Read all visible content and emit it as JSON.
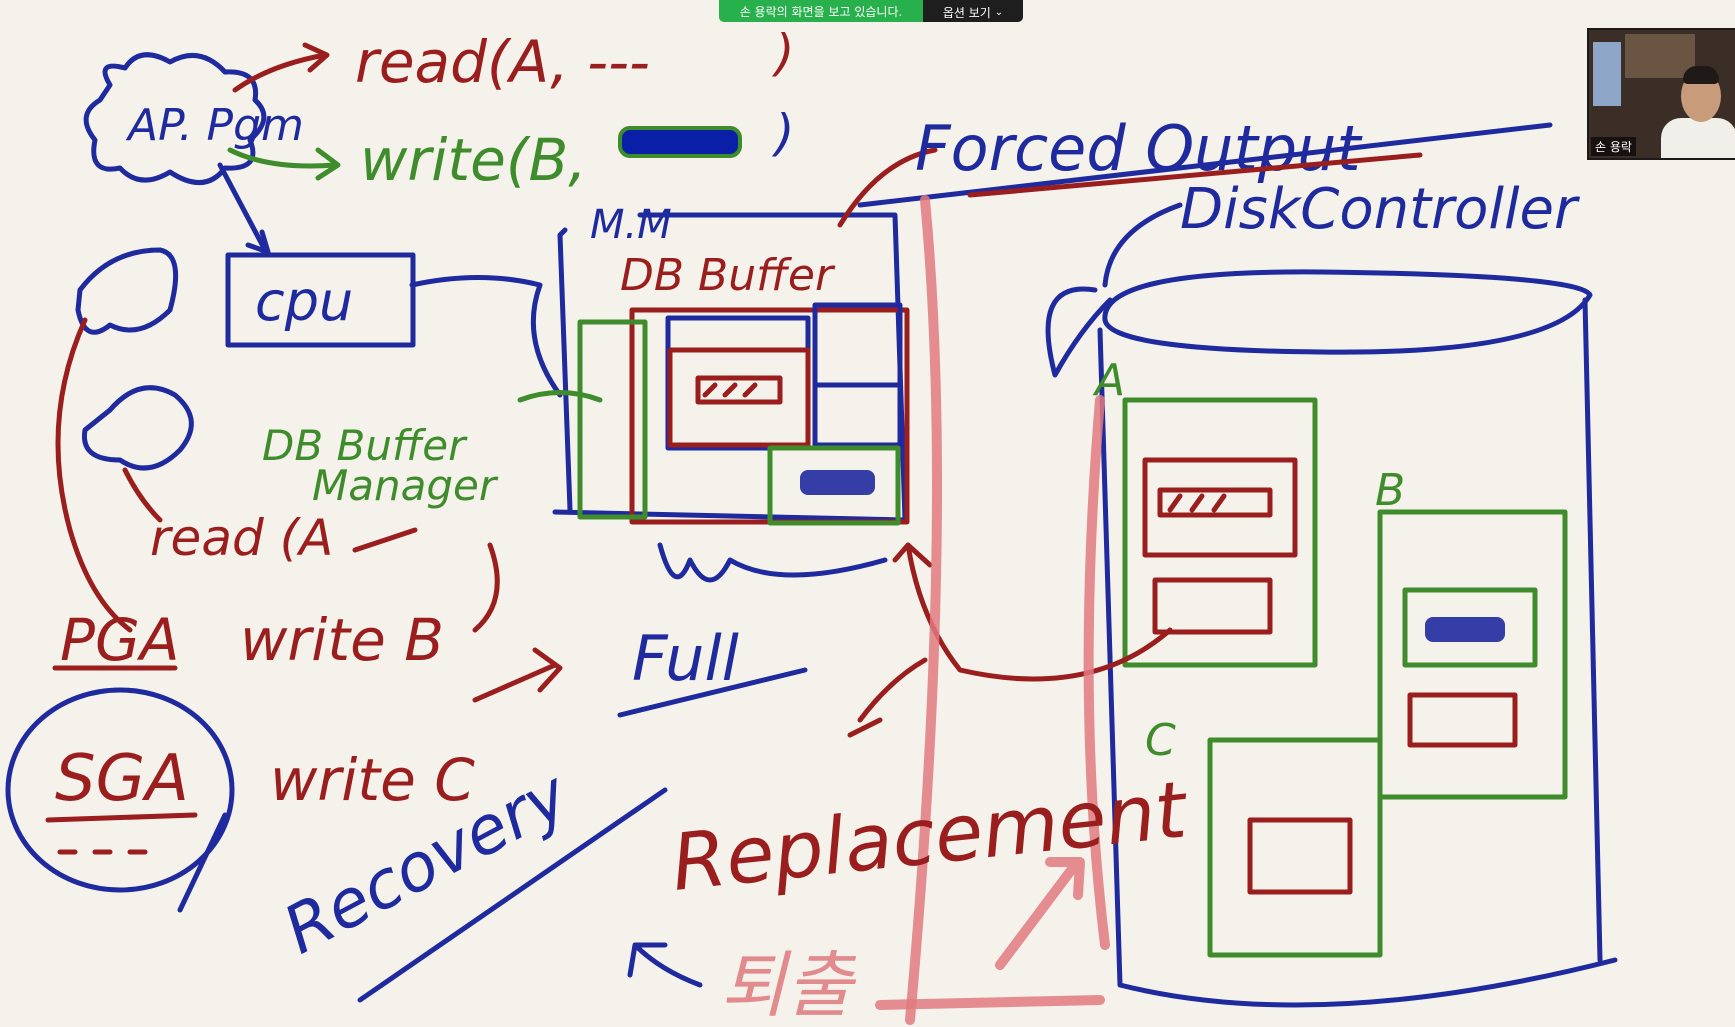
{
  "share_bar": {
    "status_text": "손 용락의 화면을 보고 있습니다.",
    "view_options_label": "옵션 보기",
    "status_color": "#27b04b"
  },
  "participant": {
    "name": "손 용락"
  },
  "whiteboard": {
    "ap_pgm": "AP. Pgm",
    "read_a": "read(A, ---",
    "write_b": "write(B,",
    "cpu": "cpu",
    "mm": "M.M",
    "db_buffer": "DB Buffer",
    "db_buffer_manager_1": "DB Buffer",
    "db_buffer_manager_2": "Manager",
    "forced_output": "Forced Output",
    "disk_controller": "DiskController",
    "full": "Full",
    "read_a2": "read (A",
    "write_b2": "write B",
    "write_c": "write C",
    "pga": "PGA",
    "sga": "SGA",
    "recovery": "Recovery",
    "replacement": "Replacement",
    "disk_a": "A",
    "disk_b": "B",
    "disk_c": "C",
    "korean_note": "퇴출"
  },
  "colors": {
    "background": "#f4f2ea",
    "blue_ink": "#1f2a9e",
    "red_ink": "#9b1e1e",
    "green_ink": "#3f8c2c",
    "pink_ink": "#e07a7f"
  }
}
